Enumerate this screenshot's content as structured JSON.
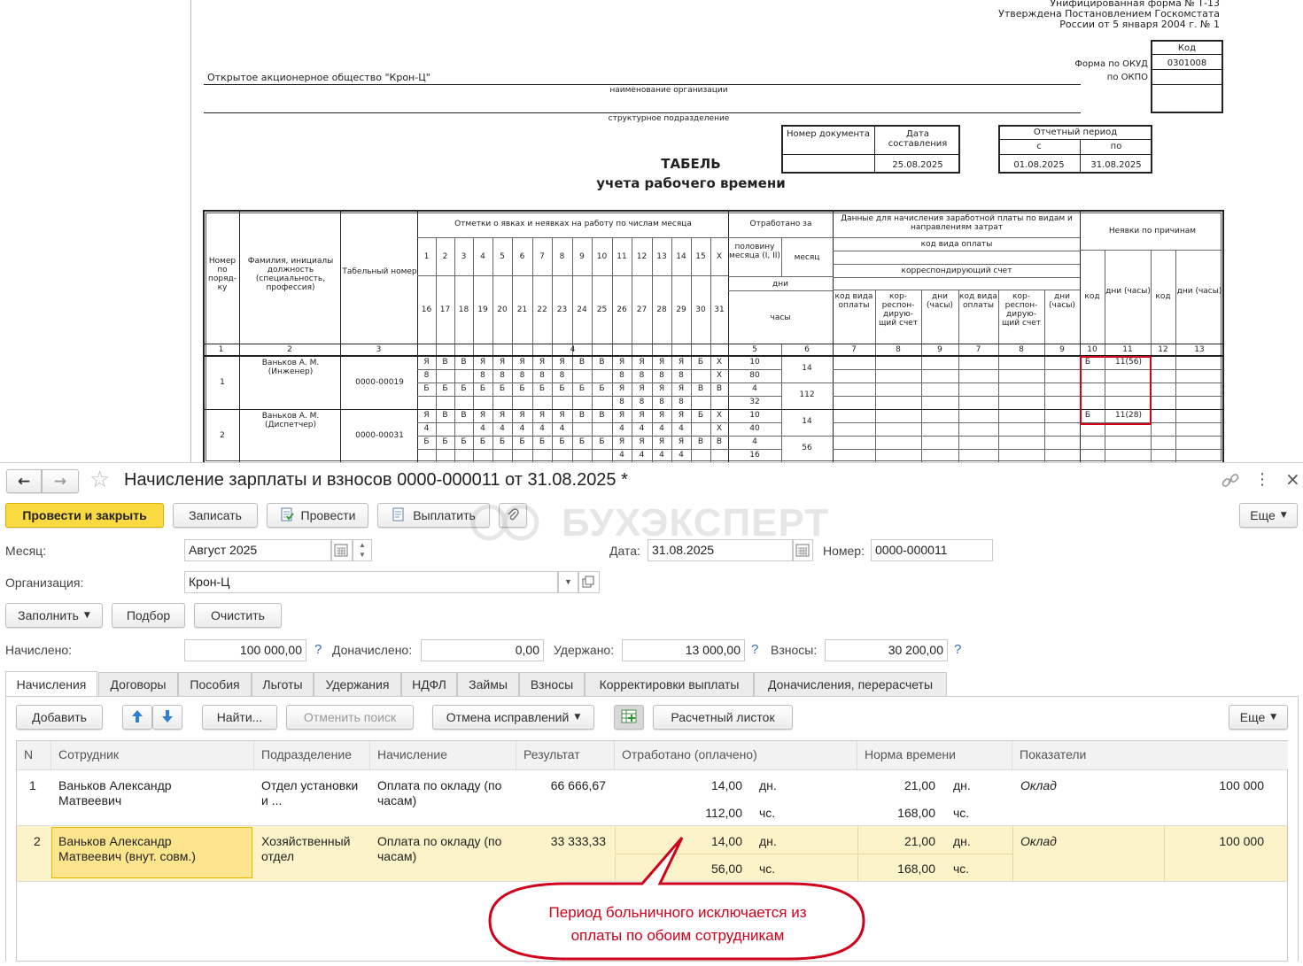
{
  "form": {
    "unified_line1": "Унифицированная форма № Т-13",
    "unified_line2": "Утверждена Постановлением Госкомстата",
    "unified_line3": "России от 5 января 2004 г. № 1",
    "code_header": "Код",
    "okud_label": "Форма по ОКУД",
    "okud_value": "0301008",
    "okpo_label": "по ОКПО",
    "org_name": "Открытое акционерное общество \"Крон-Ц\"",
    "org_caption": "наименование организации",
    "dept_caption": "структурное подразделение",
    "doc_number_label": "Номер документа",
    "doc_date_label": "Дата составления",
    "doc_date_value": "25.08.2025",
    "period_label": "Отчетный период",
    "period_from_label": "с",
    "period_to_label": "по",
    "period_from": "01.08.2025",
    "period_to": "31.08.2025",
    "title_line1": "ТАБЕЛЬ",
    "title_line2": "учета  рабочего времени"
  },
  "timesheet": {
    "h_num": "Номер по поряд-ку",
    "h_name": "Фамилия, инициалы должность (специальность, профессия)",
    "h_tab": "Табельный номер",
    "h_marks": "Отметки о явках и неявках на работу по числам месяца",
    "h_worked": "Отработано за",
    "h_half": "половину месяца (I, II)",
    "h_month": "месяц",
    "h_days": "дни",
    "h_hours": "часы",
    "h_pay": "Данные для начисления заработной платы по видам и направлениям затрат",
    "h_paycode": "код вида оплаты",
    "h_corr": "корреспондирующий счет",
    "h_sub_code": "код вида оплаты",
    "h_sub_corr": "кор-респон-дирую-щий счет",
    "h_sub_dh": "дни (часы)",
    "h_absence": "Неявки по причинам",
    "h_abs_code": "код",
    "h_abs_dh": "дни (часы)",
    "days_row1": [
      "1",
      "2",
      "3",
      "4",
      "5",
      "6",
      "7",
      "8",
      "9",
      "10",
      "11",
      "12",
      "13",
      "14",
      "15",
      "Х"
    ],
    "days_row2": [
      "16",
      "17",
      "18",
      "19",
      "20",
      "21",
      "22",
      "23",
      "24",
      "25",
      "26",
      "27",
      "28",
      "29",
      "30",
      "31"
    ],
    "colnums": [
      "1",
      "2",
      "3",
      "4",
      "5",
      "6",
      "7",
      "8",
      "9",
      "7",
      "8",
      "9",
      "10",
      "11",
      "12",
      "13"
    ],
    "rows": [
      {
        "num": "1",
        "name": "Ваньков А. М. (Инженер)",
        "tab": "0000-00019",
        "marks": [
          [
            "Я",
            "В",
            "В",
            "Я",
            "Я",
            "Я",
            "Я",
            "Я",
            "В",
            "В",
            "Я",
            "Я",
            "Я",
            "Я",
            "Б",
            "Х"
          ],
          [
            "8",
            "",
            "",
            "8",
            "8",
            "8",
            "8",
            "8",
            "",
            "",
            "8",
            "8",
            "8",
            "8",
            "",
            "Х"
          ],
          [
            "Б",
            "Б",
            "Б",
            "Б",
            "Б",
            "Б",
            "Б",
            "Б",
            "Б",
            "Б",
            "Я",
            "Я",
            "Я",
            "Я",
            "В",
            "В"
          ],
          [
            "",
            "",
            "",
            "",
            "",
            "",
            "",
            "",
            "",
            "",
            "8",
            "8",
            "8",
            "8",
            "",
            ""
          ]
        ],
        "half1_days": "10",
        "half1_hours": "80",
        "half2_days": "4",
        "half2_hours": "32",
        "month_days": "14",
        "month_hours": "112",
        "abs_code": "Б",
        "abs_dh": "11(56)"
      },
      {
        "num": "2",
        "name": "Ваньков А. М. (Диспетчер)",
        "tab": "0000-00031",
        "marks": [
          [
            "Я",
            "В",
            "В",
            "Я",
            "Я",
            "Я",
            "Я",
            "Я",
            "В",
            "В",
            "Я",
            "Я",
            "Я",
            "Я",
            "Б",
            "Х"
          ],
          [
            "4",
            "",
            "",
            "4",
            "4",
            "4",
            "4",
            "4",
            "",
            "",
            "4",
            "4",
            "4",
            "4",
            "",
            "Х"
          ],
          [
            "Б",
            "Б",
            "Б",
            "Б",
            "Б",
            "Б",
            "Б",
            "Б",
            "Б",
            "Б",
            "Я",
            "Я",
            "Я",
            "Я",
            "В",
            "В"
          ],
          [
            "",
            "",
            "",
            "",
            "",
            "",
            "",
            "",
            "",
            "",
            "4",
            "4",
            "4",
            "4",
            "",
            ""
          ]
        ],
        "half1_days": "10",
        "half1_hours": "40",
        "half2_days": "4",
        "half2_hours": "16",
        "month_days": "14",
        "month_hours": "56",
        "abs_code": "Б",
        "abs_dh": "11(28)"
      }
    ]
  },
  "window": {
    "title": "Начисление зарплаты и взносов 0000-000011 от 31.08.2025 *",
    "nav_back": "←",
    "nav_fwd": "→",
    "star": "☆",
    "link": "🔗",
    "more": "⋮",
    "close": "×"
  },
  "toolbar": {
    "post_close": "Провести и закрыть",
    "save": "Записать",
    "post": "Провести",
    "pay": "Выплатить",
    "more": "Еще",
    "watermark": "БУХЭКСПЕРТ"
  },
  "header_fields": {
    "month_label": "Месяц:",
    "month_value": "Август 2025",
    "date_label": "Дата:",
    "date_value": "31.08.2025",
    "number_label": "Номер:",
    "number_value": "0000-000011",
    "org_label": "Организация:",
    "org_value": "Крон-Ц"
  },
  "actions": {
    "fill": "Заполнить",
    "pick": "Подбор",
    "clear": "Очистить"
  },
  "totals": {
    "accrued_label": "Начислено:",
    "accrued_value": "100 000,00",
    "additional_label": "Доначислено:",
    "additional_value": "0,00",
    "withheld_label": "Удержано:",
    "withheld_value": "13 000,00",
    "contrib_label": "Взносы:",
    "contrib_value": "30 200,00",
    "help": "?"
  },
  "tabs": [
    "Начисления",
    "Договоры",
    "Пособия",
    "Льготы",
    "Удержания",
    "НДФЛ",
    "Займы",
    "Взносы",
    "Корректировки выплаты",
    "Доначисления, перерасчеты"
  ],
  "table_toolbar": {
    "add": "Добавить",
    "find": "Найти...",
    "cancel_search": "Отменить поиск",
    "cancel_fix": "Отмена исправлений",
    "payslip": "Расчетный листок",
    "more": "Еще"
  },
  "grid": {
    "columns": [
      "N",
      "Сотрудник",
      "Подразделение",
      "Начисление",
      "Результат",
      "Отработано (оплачено)",
      "Норма времени",
      "Показатели"
    ],
    "rows": [
      {
        "n": "1",
        "employee": "Ваньков Александр Матвеевич",
        "dept": "Отдел установки и ...",
        "accrual": "Оплата по окладу (по часам)",
        "result": "66 666,67",
        "worked_days": "14,00",
        "days_unit": "дн.",
        "worked_hours": "112,00",
        "hours_unit": "чс.",
        "norm_days": "21,00",
        "norm_hours": "168,00",
        "indicator": "Оклад",
        "indicator_value": "100 000"
      },
      {
        "n": "2",
        "employee": "Ваньков Александр Матвеевич (внут. совм.)",
        "dept": "Хозяйственный отдел",
        "accrual": "Оплата по окладу (по часам)",
        "result": "33 333,33",
        "worked_days": "14,00",
        "days_unit": "дн.",
        "worked_hours": "56,00",
        "hours_unit": "чс.",
        "norm_days": "21,00",
        "norm_hours": "168,00",
        "indicator": "Оклад",
        "indicator_value": "100 000"
      }
    ]
  },
  "callout": {
    "line1": "Период больничного исключается из",
    "line2": "оплаты по обоим сотрудникам"
  },
  "colors": {
    "accent_yellow": "#fbd940",
    "selected_row": "#fdf3c8",
    "callout_red": "#d0011b",
    "help_blue": "#2f6dbd"
  }
}
